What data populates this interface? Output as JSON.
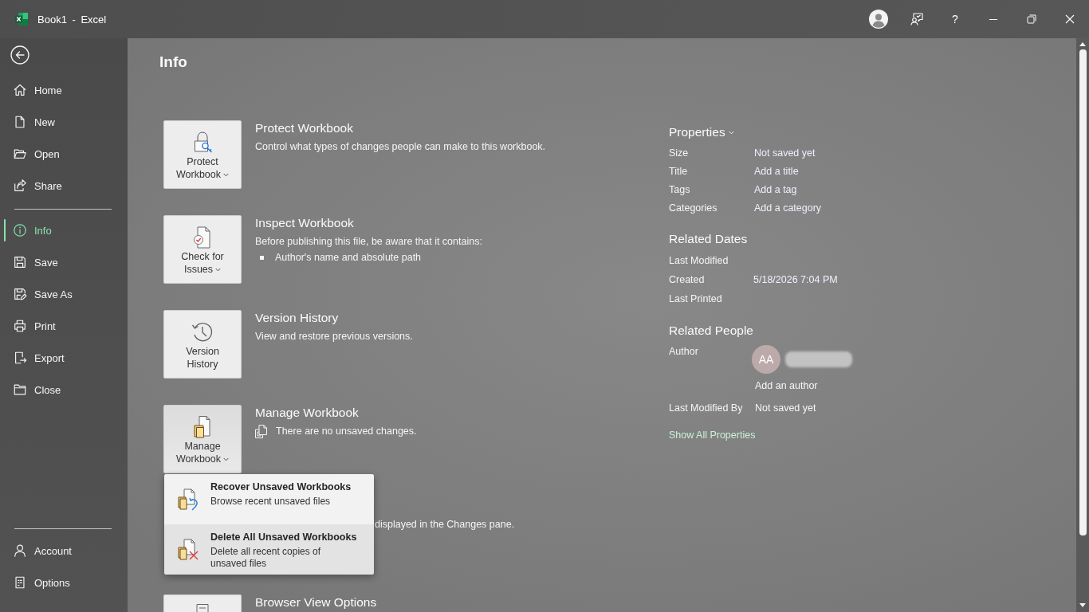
{
  "title_bar": {
    "title": "Book1 - Excel",
    "help": "?"
  },
  "sidebar": {
    "sections": [
      {
        "items": [
          {
            "label": "Home",
            "selected": false
          },
          {
            "label": "New",
            "selected": false
          },
          {
            "label": "Open",
            "selected": false
          },
          {
            "label": "Share",
            "selected": false
          }
        ]
      },
      {
        "items": [
          {
            "label": "Info",
            "selected": true
          },
          {
            "label": "Save",
            "selected": false
          },
          {
            "label": "Save As",
            "selected": false
          },
          {
            "label": "Print",
            "selected": false
          },
          {
            "label": "Export",
            "selected": false
          },
          {
            "label": "Close",
            "selected": false
          }
        ]
      },
      {
        "items": [
          {
            "label": "Account",
            "selected": false
          },
          {
            "label": "Options",
            "selected": false
          }
        ]
      }
    ]
  },
  "page": {
    "title": "Info"
  },
  "sections": [
    {
      "kind": "full",
      "button": {
        "label": "Protect Workbook",
        "dropdown": true,
        "expanded": false
      },
      "title": "Protect Workbook",
      "description": "Control what types of changes people can make to this workbook."
    },
    {
      "kind": "full",
      "button": {
        "label": "Check for Issues",
        "dropdown": true,
        "expanded": false
      },
      "title": "Inspect Workbook",
      "description": "Before publishing this file, be aware that it contains:",
      "bullets": [
        "Author's name and absolute path"
      ]
    },
    {
      "kind": "full",
      "button": {
        "label": "Version History",
        "dropdown": false,
        "expanded": false
      },
      "title": "Version History",
      "description": "View and restore previous versions."
    },
    {
      "kind": "full",
      "button": {
        "label": "Manage Workbook",
        "dropdown": true,
        "expanded": true
      },
      "title": "Manage Workbook",
      "status": "There are no unsaved changes.",
      "menu": [
        {
          "title": "Recover Unsaved Workbooks",
          "description": "Browse recent unsaved files",
          "selected": false
        },
        {
          "title": "Delete All Unsaved Workbooks",
          "description": "Delete all recent copies of unsaved files",
          "selected": true
        }
      ]
    },
    {
      "kind": "covered",
      "description": "displayed in the Changes pane."
    },
    {
      "kind": "cut",
      "title": "Browser View Options"
    }
  ],
  "properties": {
    "heading": "Properties",
    "rows": [
      {
        "label": "Size",
        "value": "Not saved yet"
      },
      {
        "label": "Title",
        "value": "Add a title"
      },
      {
        "label": "Tags",
        "value": "Add a tag"
      },
      {
        "label": "Categories",
        "value": "Add a category"
      }
    ]
  },
  "related_dates": {
    "heading": "Related Dates",
    "rows": [
      {
        "label": "Last Modified"
      },
      {
        "label": "Created",
        "value": "5/18/2026 7:04 PM"
      },
      {
        "label": "Last Printed"
      }
    ]
  },
  "related_people": {
    "heading": "Related People",
    "author": {
      "label": "Author",
      "initials": "AA",
      "redacted": true,
      "add_label": "Add an author"
    },
    "rows": [
      {
        "label": "Last Modified By",
        "value": "Not saved yet"
      }
    ]
  },
  "show_all": "Show All Properties"
}
